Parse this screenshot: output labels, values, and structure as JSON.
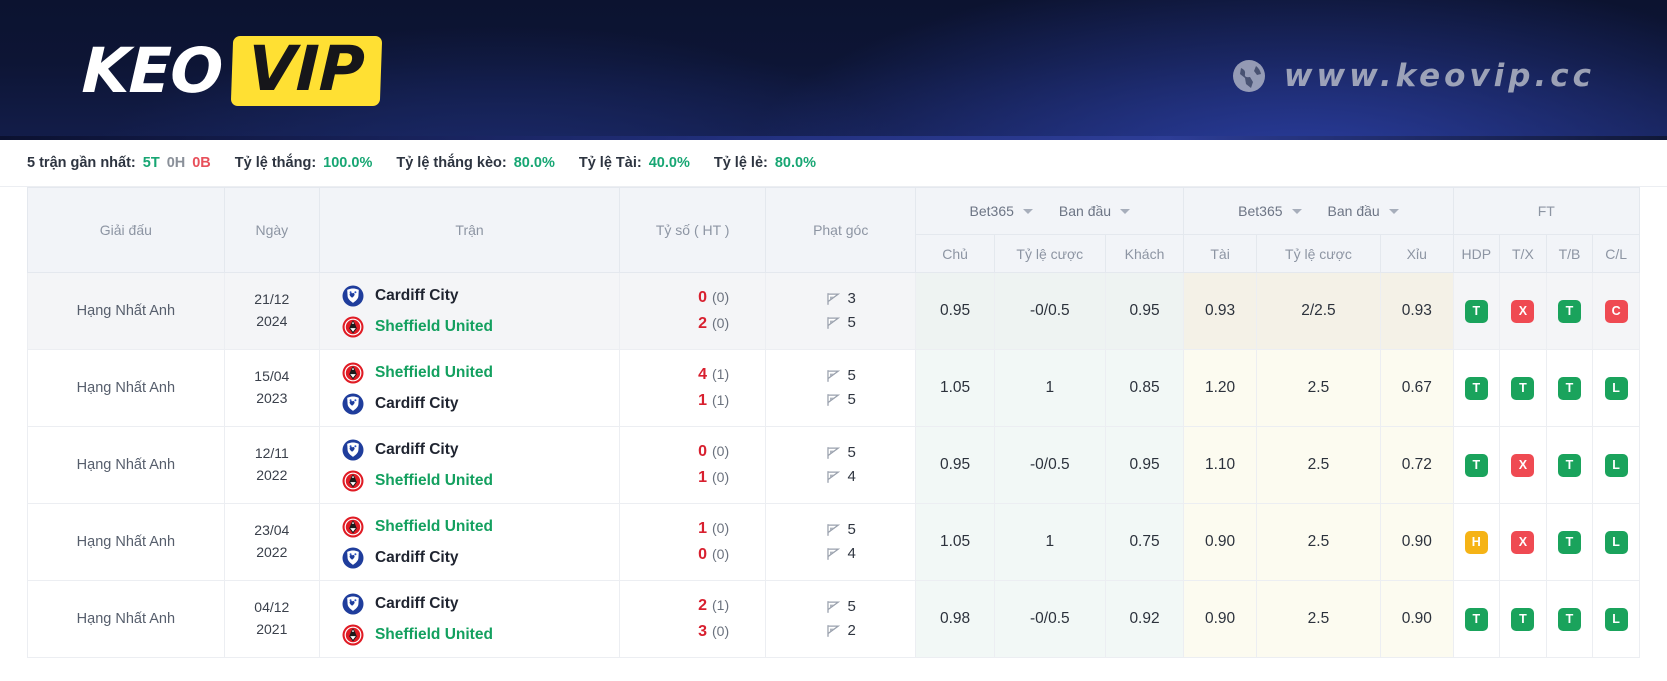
{
  "header": {
    "logo_primary": "KEO",
    "logo_accent": "VIP",
    "site_url": "www.keovip.cc",
    "globe_icon": "globe-icon",
    "accent_color": "#ffe033",
    "bg_color": "#0d1535"
  },
  "stats": [
    {
      "label": "5 trận gần nhất:",
      "wdl": [
        {
          "text": "5T",
          "color": "#17a673"
        },
        {
          "text": "0H",
          "color": "#8a9099"
        },
        {
          "text": "0B",
          "color": "#e8505b"
        }
      ]
    },
    {
      "label": "Tỷ lệ thắng:",
      "value": "100.0%",
      "color": "#17a673"
    },
    {
      "label": "Tỷ lệ thắng kèo:",
      "value": "80.0%",
      "color": "#17a673"
    },
    {
      "label": "Tỷ lệ Tài:",
      "value": "40.0%",
      "color": "#17a673"
    },
    {
      "label": "Tỷ lệ lẻ:",
      "value": "80.0%",
      "color": "#17a673"
    }
  ],
  "table": {
    "headers": {
      "league": "Giải đấu",
      "date": "Ngày",
      "match": "Trận",
      "score": "Tỷ số ( HT )",
      "corner": "Phạt góc",
      "group_handicap_book": "Bet365",
      "group_handicap_time": "Ban đầu",
      "group_ou_book": "Bet365",
      "group_ou_time": "Ban đầu",
      "group_ft": "FT",
      "home": "Chủ",
      "rate_hdp": "Tỷ lệ cược",
      "away": "Khách",
      "over": "Tài",
      "rate_ou": "Tỷ lệ cược",
      "under": "Xỉu",
      "ft_hdp": "HDP",
      "ft_tx": "T/X",
      "ft_tb": "T/B",
      "ft_cl": "C/L"
    },
    "rows": [
      {
        "league": "Hạng Nhất Anh",
        "date_day": "21/12",
        "date_year": "2024",
        "home_team": "Cardiff City",
        "home_highlight": false,
        "away_team": "Sheffield United",
        "away_highlight": true,
        "home_score": "0",
        "home_ht": "(0)",
        "away_score": "2",
        "away_ht": "(0)",
        "corner_home": "3",
        "corner_away": "5",
        "hdp_home": "0.95",
        "hdp_line": "-0/0.5",
        "hdp_away": "0.95",
        "ou_over": "0.93",
        "ou_line": "2/2.5",
        "ou_under": "0.93",
        "ft": [
          {
            "text": "T",
            "type": "T"
          },
          {
            "text": "X",
            "type": "X"
          },
          {
            "text": "T",
            "type": "T"
          },
          {
            "text": "C",
            "type": "C"
          }
        ]
      },
      {
        "league": "Hạng Nhất Anh",
        "date_day": "15/04",
        "date_year": "2023",
        "home_team": "Sheffield United",
        "home_highlight": true,
        "away_team": "Cardiff City",
        "away_highlight": false,
        "home_score": "4",
        "home_ht": "(1)",
        "away_score": "1",
        "away_ht": "(1)",
        "corner_home": "5",
        "corner_away": "5",
        "hdp_home": "1.05",
        "hdp_line": "1",
        "hdp_away": "0.85",
        "ou_over": "1.20",
        "ou_line": "2.5",
        "ou_under": "0.67",
        "ft": [
          {
            "text": "T",
            "type": "T"
          },
          {
            "text": "T",
            "type": "T"
          },
          {
            "text": "T",
            "type": "T"
          },
          {
            "text": "L",
            "type": "L"
          }
        ]
      },
      {
        "league": "Hạng Nhất Anh",
        "date_day": "12/11",
        "date_year": "2022",
        "home_team": "Cardiff City",
        "home_highlight": false,
        "away_team": "Sheffield United",
        "away_highlight": true,
        "home_score": "0",
        "home_ht": "(0)",
        "away_score": "1",
        "away_ht": "(0)",
        "corner_home": "5",
        "corner_away": "4",
        "hdp_home": "0.95",
        "hdp_line": "-0/0.5",
        "hdp_away": "0.95",
        "ou_over": "1.10",
        "ou_line": "2.5",
        "ou_under": "0.72",
        "ft": [
          {
            "text": "T",
            "type": "T"
          },
          {
            "text": "X",
            "type": "X"
          },
          {
            "text": "T",
            "type": "T"
          },
          {
            "text": "L",
            "type": "L"
          }
        ]
      },
      {
        "league": "Hạng Nhất Anh",
        "date_day": "23/04",
        "date_year": "2022",
        "home_team": "Sheffield United",
        "home_highlight": true,
        "away_team": "Cardiff City",
        "away_highlight": false,
        "home_score": "1",
        "home_ht": "(0)",
        "away_score": "0",
        "away_ht": "(0)",
        "corner_home": "5",
        "corner_away": "4",
        "hdp_home": "1.05",
        "hdp_line": "1",
        "hdp_away": "0.75",
        "ou_over": "0.90",
        "ou_line": "2.5",
        "ou_under": "0.90",
        "ft": [
          {
            "text": "H",
            "type": "H"
          },
          {
            "text": "X",
            "type": "X"
          },
          {
            "text": "T",
            "type": "T"
          },
          {
            "text": "L",
            "type": "L"
          }
        ]
      },
      {
        "league": "Hạng Nhất Anh",
        "date_day": "04/12",
        "date_year": "2021",
        "home_team": "Cardiff City",
        "home_highlight": false,
        "away_team": "Sheffield United",
        "away_highlight": true,
        "home_score": "2",
        "home_ht": "(1)",
        "away_score": "3",
        "away_ht": "(0)",
        "corner_home": "5",
        "corner_away": "2",
        "hdp_home": "0.98",
        "hdp_line": "-0/0.5",
        "hdp_away": "0.92",
        "ou_over": "0.90",
        "ou_line": "2.5",
        "ou_under": "0.90",
        "ft": [
          {
            "text": "T",
            "type": "T"
          },
          {
            "text": "T",
            "type": "T"
          },
          {
            "text": "T",
            "type": "T"
          },
          {
            "text": "L",
            "type": "L"
          }
        ]
      }
    ]
  }
}
